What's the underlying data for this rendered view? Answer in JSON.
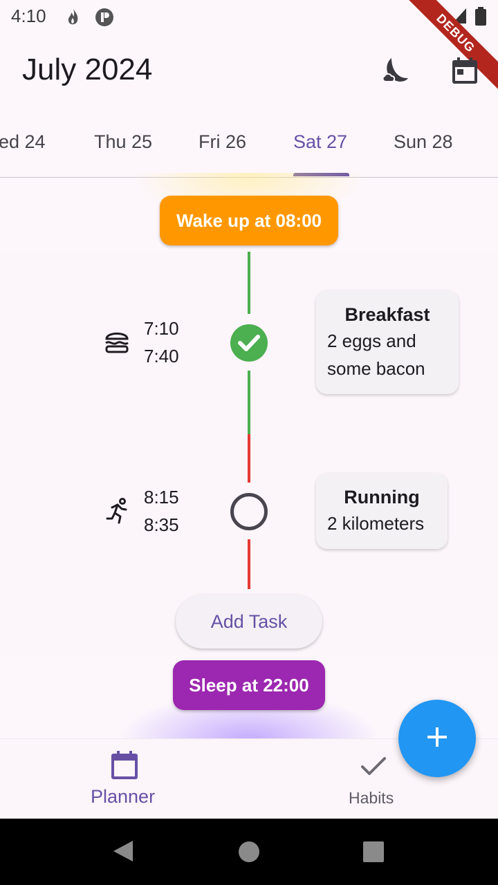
{
  "status_bar": {
    "time": "4:10",
    "debug_label": "DEBUG"
  },
  "header": {
    "title": "July 2024",
    "icons": [
      "moon-icon",
      "calendar-icon"
    ]
  },
  "tabs": [
    {
      "label": "ed 24"
    },
    {
      "label": "Thu 25"
    },
    {
      "label": "Fri 26"
    },
    {
      "label": "Sat 27",
      "active": true
    },
    {
      "label": "Sun 28"
    }
  ],
  "timeline": {
    "wake": "Wake up at 08:00",
    "sleep": "Sleep at 22:00",
    "tasks": [
      {
        "icon": "burger-icon",
        "start": "7:10",
        "end": "7:40",
        "title": "Breakfast",
        "desc_line1": "2 eggs and",
        "desc_line2": "some bacon",
        "done": true
      },
      {
        "icon": "running-icon",
        "start": "8:15",
        "end": "8:35",
        "title": "Running",
        "desc": "2 kilometers",
        "done": false
      }
    ],
    "add_task": "Add Task"
  },
  "bottom_nav": {
    "planner": "Planner",
    "habits": "Habits"
  },
  "colors": {
    "accent": "#6750a4",
    "wake": "#ff9800",
    "sleep": "#9c27b0",
    "done": "#4caf50",
    "pending": "#e53935",
    "fab": "#2196f3"
  }
}
